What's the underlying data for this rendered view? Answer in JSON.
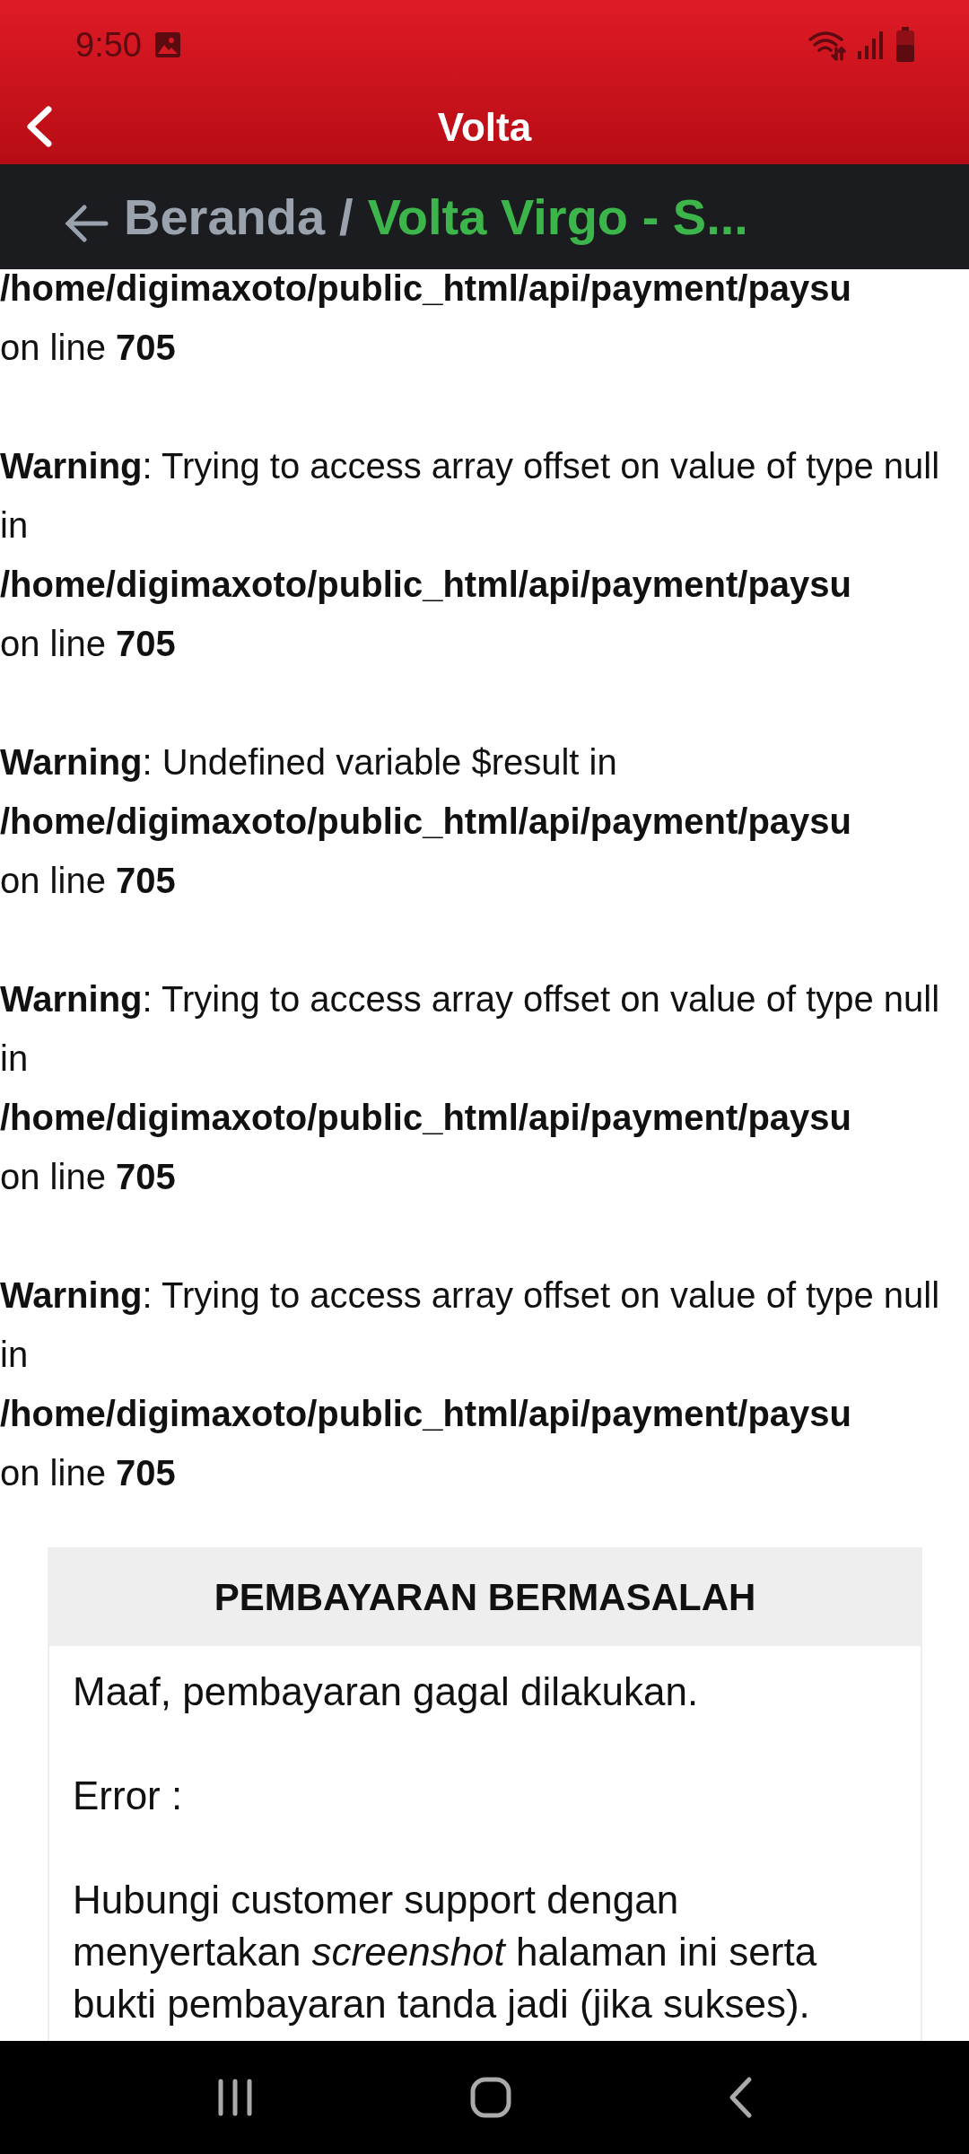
{
  "status_bar": {
    "time": "9:50"
  },
  "app_bar": {
    "title": "Volta"
  },
  "breadcrumb": {
    "items": [
      {
        "label": "Beranda",
        "selected": false
      },
      {
        "label": "Volta Virgo - S...",
        "selected": true
      }
    ],
    "separator": "/"
  },
  "log": [
    {
      "path": "/home/digimaxoto/public_html/api/payment/paysu",
      "line": "on line **705**"
    },
    {
      "message": "**Warning**: Trying to access array offset on value of type null in",
      "path": "/home/digimaxoto/public_html/api/payment/paysu",
      "line": "on line **705**"
    },
    {
      "message": "**Warning**: Undefined variable $result in",
      "path": "/home/digimaxoto/public_html/api/payment/paysu",
      "line": "on line **705**"
    },
    {
      "message": "**Warning**: Trying to access array offset on value of type null in",
      "path": "/home/digimaxoto/public_html/api/payment/paysu",
      "line": "on line **705**"
    },
    {
      "message": "**Warning**: Trying to access array offset on value of type null in",
      "path": "/home/digimaxoto/public_html/api/payment/paysu",
      "line": "on line **705**"
    }
  ],
  "card": {
    "title": "PEMBAYARAN BERMASALAH",
    "paragraphs": [
      "Maaf, pembayaran gagal dilakukan.",
      "Error :",
      "Hubungi customer support dengan menyertakan *screenshot* halaman ini serta bukti pembayaran tanda jadi (jika sukses)."
    ]
  }
}
